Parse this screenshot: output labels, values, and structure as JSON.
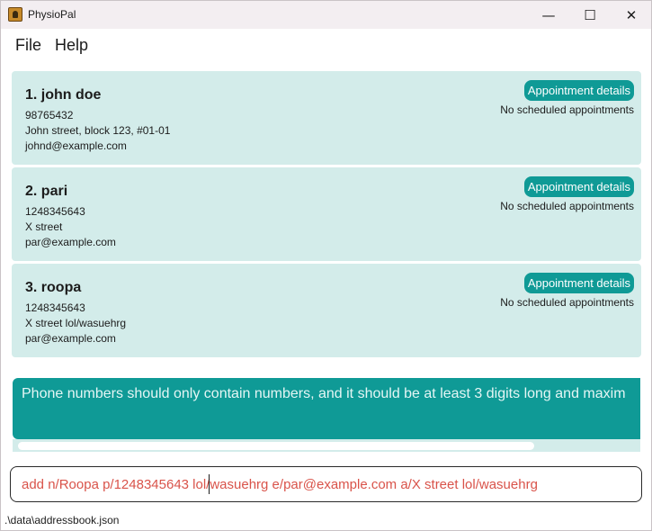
{
  "window": {
    "title": "PhysioPal",
    "minimize_glyph": "—",
    "maximize_glyph": "☐",
    "close_glyph": "✕"
  },
  "menu": {
    "file": "File",
    "help": "Help"
  },
  "persons": [
    {
      "index_name": "1.  john doe",
      "phone": "98765432",
      "address": "John street, block 123, #01-01",
      "email": "johnd@example.com",
      "appointment_button": "Appointment details",
      "appointment_status": "No scheduled appointments"
    },
    {
      "index_name": "2.  pari",
      "phone": "1248345643",
      "address": "X street",
      "email": "par@example.com",
      "appointment_button": "Appointment details",
      "appointment_status": "No scheduled appointments"
    },
    {
      "index_name": "3.  roopa",
      "phone": "1248345643",
      "address": "X street lol/wasuehrg",
      "email": "par@example.com",
      "appointment_button": "Appointment details",
      "appointment_status": "No scheduled appointments"
    }
  ],
  "result": {
    "message": "Phone numbers should only contain numbers, and it should be at least 3 digits long and maxim"
  },
  "command": {
    "value": "add n/Roopa p/1248345643 lol/wasuehrg e/par@example.com a/X street lol/wasuehrg"
  },
  "status_bar": {
    "path": ".\\data\\addressbook.json"
  },
  "colors": {
    "card_bg": "#d3ecea",
    "accent": "#0f9a96",
    "error_text": "#d9534a"
  },
  "icons": {
    "app": "physiopal-app-icon"
  }
}
